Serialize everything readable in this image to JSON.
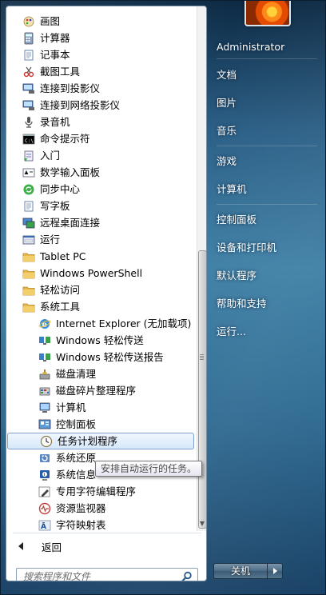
{
  "programs": [
    {
      "label": "画图",
      "icon": "paint-icon",
      "level": 0
    },
    {
      "label": "计算器",
      "icon": "calculator-icon",
      "level": 0
    },
    {
      "label": "记事本",
      "icon": "notepad-icon",
      "level": 0
    },
    {
      "label": "截图工具",
      "icon": "snipping-tool-icon",
      "level": 0
    },
    {
      "label": "连接到投影仪",
      "icon": "projector-icon",
      "level": 0
    },
    {
      "label": "连接到网络投影仪",
      "icon": "network-projector-icon",
      "level": 0
    },
    {
      "label": "录音机",
      "icon": "microphone-icon",
      "level": 0
    },
    {
      "label": "命令提示符",
      "icon": "cmd-icon",
      "level": 0
    },
    {
      "label": "入门",
      "icon": "getting-started-icon",
      "level": 0
    },
    {
      "label": "数学输入面板",
      "icon": "math-input-icon",
      "level": 0
    },
    {
      "label": "同步中心",
      "icon": "sync-center-icon",
      "level": 0
    },
    {
      "label": "写字板",
      "icon": "wordpad-icon",
      "level": 0
    },
    {
      "label": "远程桌面连接",
      "icon": "remote-desktop-icon",
      "level": 0
    },
    {
      "label": "运行",
      "icon": "run-icon",
      "level": 0
    },
    {
      "label": "Tablet PC",
      "icon": "folder-icon",
      "level": 0
    },
    {
      "label": "Windows PowerShell",
      "icon": "folder-icon",
      "level": 0
    },
    {
      "label": "轻松访问",
      "icon": "folder-icon",
      "level": 0
    },
    {
      "label": "系统工具",
      "icon": "folder-icon",
      "level": 0
    },
    {
      "label": "Internet Explorer (无加载项)",
      "icon": "ie-icon",
      "level": 1
    },
    {
      "label": "Windows 轻松传送",
      "icon": "easy-transfer-icon",
      "level": 1
    },
    {
      "label": "Windows 轻松传送报告",
      "icon": "easy-transfer-report-icon",
      "level": 1
    },
    {
      "label": "磁盘清理",
      "icon": "disk-cleanup-icon",
      "level": 1
    },
    {
      "label": "磁盘碎片整理程序",
      "icon": "defrag-icon",
      "level": 1
    },
    {
      "label": "计算机",
      "icon": "computer-icon",
      "level": 1
    },
    {
      "label": "控制面板",
      "icon": "control-panel-icon",
      "level": 1
    },
    {
      "label": "任务计划程序",
      "icon": "task-scheduler-icon",
      "level": 1,
      "selected": true
    },
    {
      "label": "系统还原",
      "icon": "system-restore-icon",
      "level": 1
    },
    {
      "label": "系统信息",
      "icon": "system-info-icon",
      "level": 1
    },
    {
      "label": "专用字符编辑程序",
      "icon": "char-editor-icon",
      "level": 1
    },
    {
      "label": "资源监视器",
      "icon": "resource-monitor-icon",
      "level": 1
    },
    {
      "label": "字符映射表",
      "icon": "char-map-icon",
      "level": 1
    }
  ],
  "tooltip": "安排自动运行的任务。",
  "back_label": "返回",
  "search": {
    "placeholder": "搜索程序和文件"
  },
  "right_items": [
    {
      "label": "Administrator"
    },
    {
      "label": "文档"
    },
    {
      "label": "图片"
    },
    {
      "label": "音乐"
    },
    {
      "label": "游戏"
    },
    {
      "label": "计算机"
    },
    {
      "label": "控制面板"
    },
    {
      "label": "设备和打印机"
    },
    {
      "label": "默认程序"
    },
    {
      "label": "帮助和支持"
    },
    {
      "label": "运行..."
    }
  ],
  "shutdown_label": "关机"
}
